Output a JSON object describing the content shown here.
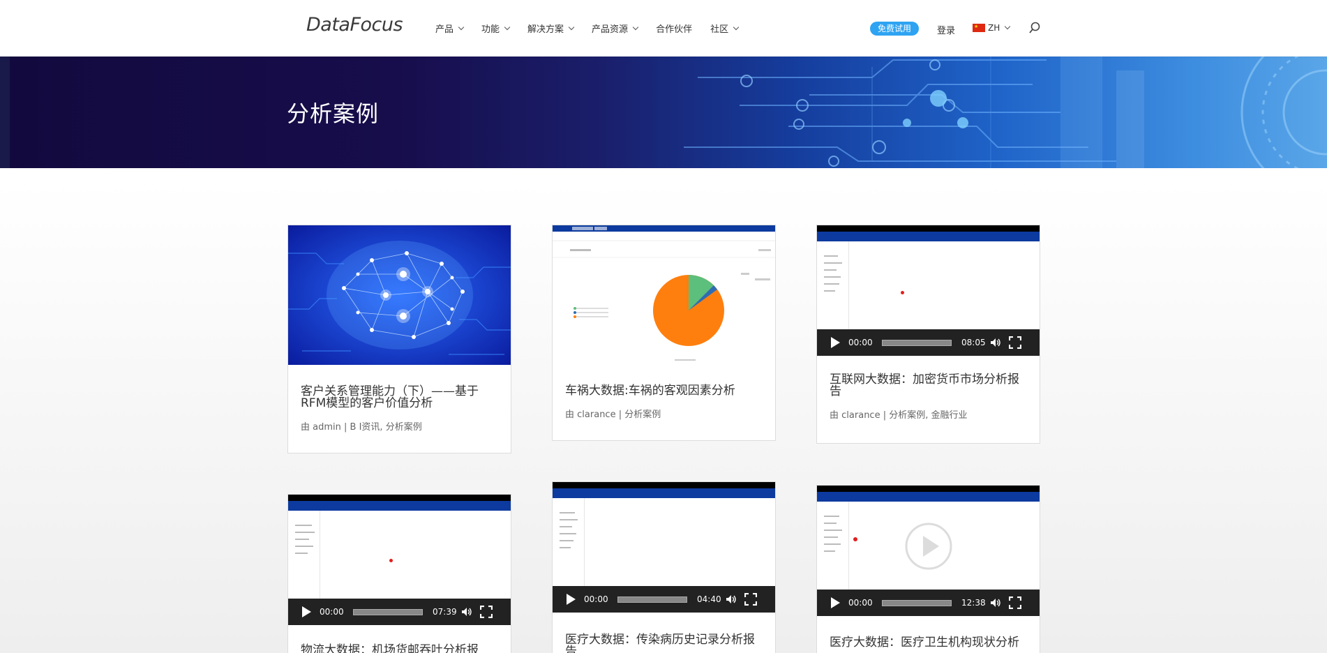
{
  "header": {
    "logo": "DataFocus",
    "nav": [
      {
        "label": "产品",
        "dropdown": true
      },
      {
        "label": "功能",
        "dropdown": true
      },
      {
        "label": "解决方案",
        "dropdown": true
      },
      {
        "label": "产品资源",
        "dropdown": true
      },
      {
        "label": "合作伙伴",
        "dropdown": false
      },
      {
        "label": "社区",
        "dropdown": true
      }
    ],
    "trial_button": "免费试用",
    "login": "登录",
    "language": "ZH"
  },
  "hero": {
    "title": "分析案例"
  },
  "cards": [
    {
      "title": "客户关系管理能力（下）——基于RFM模型的客户价值分析",
      "meta_prefix": "由",
      "author": "admin",
      "categories": "B I资讯, 分析案例",
      "media": "image-brain"
    },
    {
      "title": "车祸大数据:车祸的客观因素分析",
      "meta_prefix": "由",
      "author": "clarance",
      "categories": "分析案例",
      "media": "image-pie"
    },
    {
      "title": "互联网大数据：加密货币市场分析报告",
      "meta_prefix": "由",
      "author": "clarance",
      "categories": "分析案例, 金融行业",
      "media": "video",
      "video": {
        "current": "00:00",
        "duration": "08:05"
      }
    },
    {
      "title": "物流大数据：机场货邮吞吐分析报",
      "meta_prefix": "",
      "author": "",
      "categories": "",
      "media": "video",
      "video": {
        "current": "00:00",
        "duration": "07:39"
      }
    },
    {
      "title": "医疗大数据：传染病历史记录分析报告",
      "meta_prefix": "",
      "author": "",
      "categories": "",
      "media": "video",
      "video": {
        "current": "00:00",
        "duration": "04:40"
      }
    },
    {
      "title": "医疗大数据：医疗卫生机构现状分析",
      "meta_prefix": "",
      "author": "",
      "categories": "",
      "media": "video",
      "video": {
        "current": "00:00",
        "duration": "12:38"
      }
    }
  ],
  "colors": {
    "accent": "#2ea3f2",
    "pie_orange": "#ff7f0e",
    "pie_green": "#5cbf7c",
    "app_blue": "#0c3a9e"
  }
}
